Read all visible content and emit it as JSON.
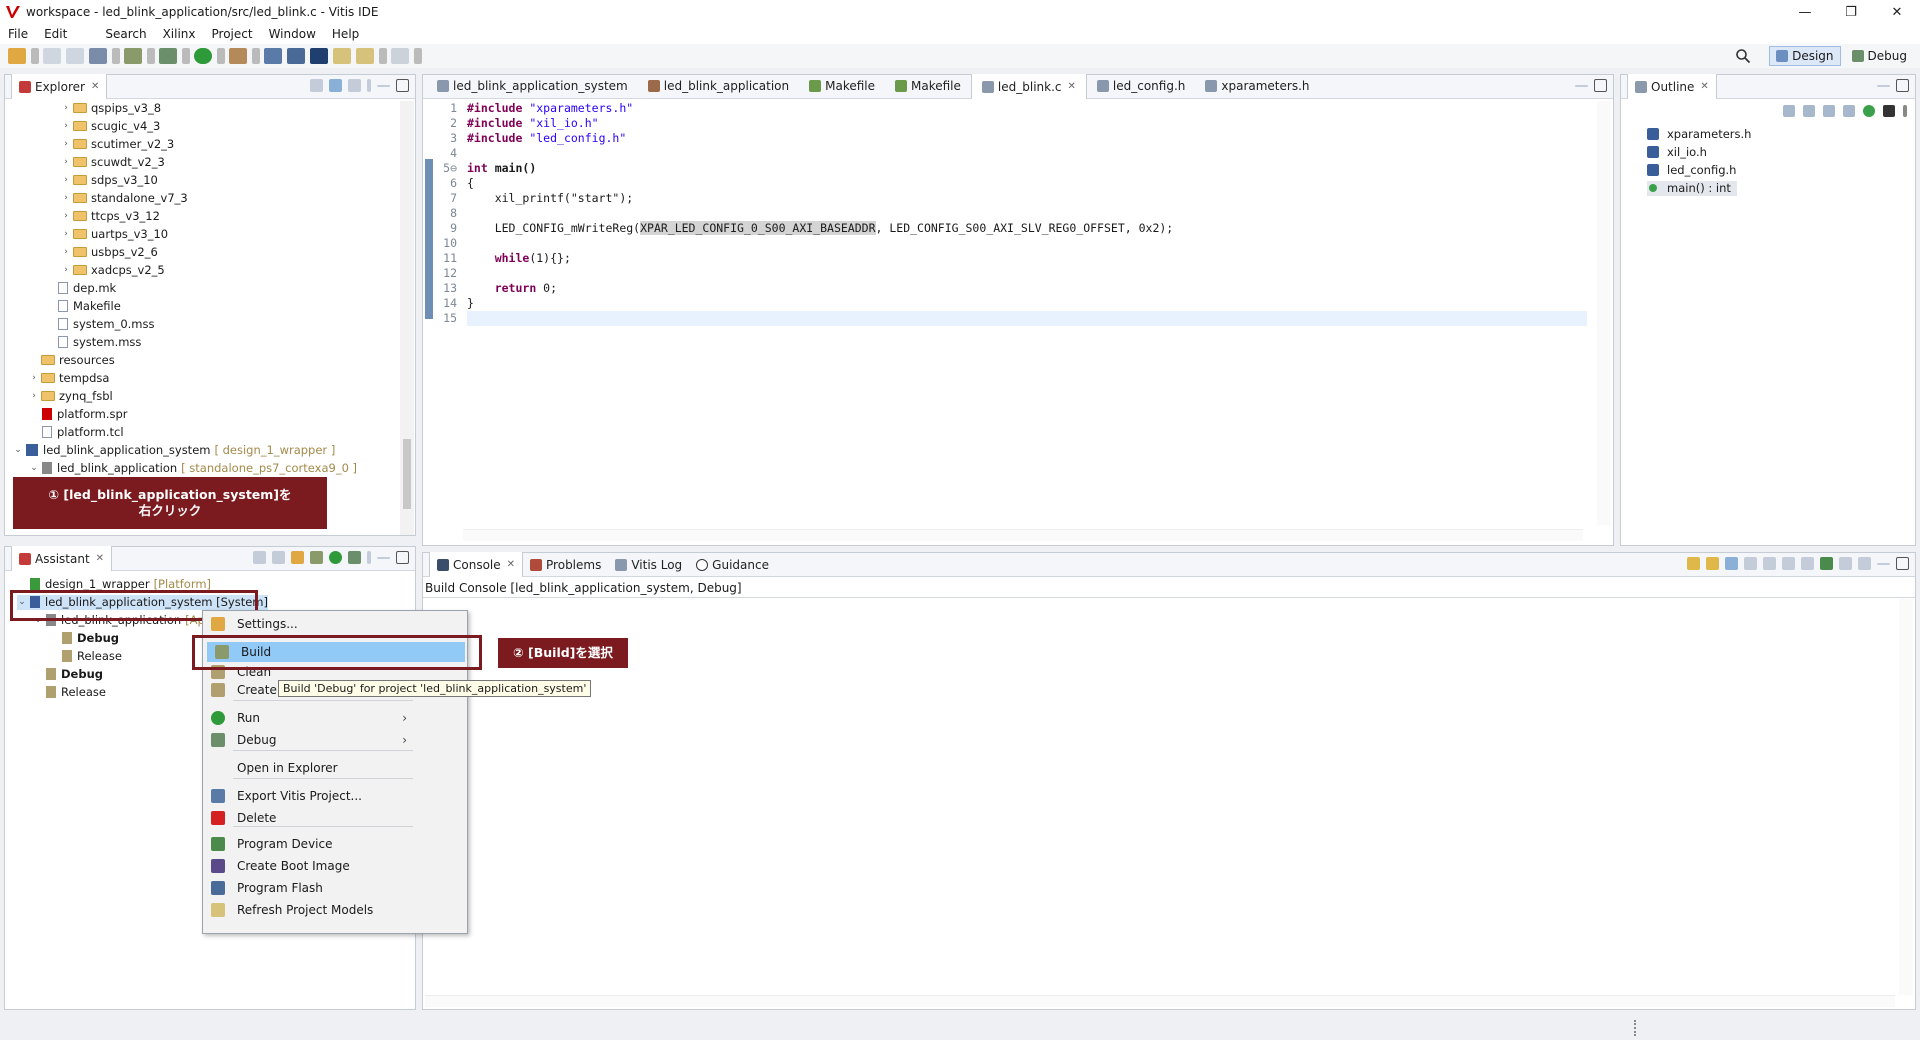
{
  "window": {
    "title": "workspace - led_blink_application/src/led_blink.c - Vitis IDE",
    "min": "—",
    "max": "❐",
    "close": "✕"
  },
  "menu": [
    "File",
    "Edit",
    "Search",
    "Xilinx",
    "Project",
    "Window",
    "Help"
  ],
  "perspectives": {
    "design": "Design",
    "debug": "Debug"
  },
  "explorer": {
    "title": "Explorer",
    "items": [
      {
        "label": "qspips_v3_8",
        "level": 3,
        "type": "folder",
        "arrow": "›"
      },
      {
        "label": "scugic_v4_3",
        "level": 3,
        "type": "folder",
        "arrow": "›"
      },
      {
        "label": "scutimer_v2_3",
        "level": 3,
        "type": "folder",
        "arrow": "›"
      },
      {
        "label": "scuwdt_v2_3",
        "level": 3,
        "type": "folder",
        "arrow": "›"
      },
      {
        "label": "sdps_v3_10",
        "level": 3,
        "type": "folder",
        "arrow": "›"
      },
      {
        "label": "standalone_v7_3",
        "level": 3,
        "type": "folder",
        "arrow": "›"
      },
      {
        "label": "ttcps_v3_12",
        "level": 3,
        "type": "folder",
        "arrow": "›"
      },
      {
        "label": "uartps_v3_10",
        "level": 3,
        "type": "folder",
        "arrow": "›"
      },
      {
        "label": "usbps_v2_6",
        "level": 3,
        "type": "folder",
        "arrow": "›"
      },
      {
        "label": "xadcps_v2_5",
        "level": 3,
        "type": "folder",
        "arrow": "›"
      },
      {
        "label": "dep.mk",
        "level": 2,
        "type": "file",
        "arrow": ""
      },
      {
        "label": "Makefile",
        "level": 2,
        "type": "file",
        "arrow": ""
      },
      {
        "label": "system_0.mss",
        "level": 2,
        "type": "file",
        "arrow": ""
      },
      {
        "label": "system.mss",
        "level": 2,
        "type": "file",
        "arrow": ""
      },
      {
        "label": "resources",
        "level": 1,
        "type": "folder",
        "arrow": ""
      },
      {
        "label": "tempdsa",
        "level": 1,
        "type": "folder",
        "arrow": "›"
      },
      {
        "label": "zynq_fsbl",
        "level": 1,
        "type": "folder",
        "arrow": "›"
      },
      {
        "label": "platform.spr",
        "level": 1,
        "type": "vitis",
        "arrow": ""
      },
      {
        "label": "platform.tcl",
        "level": 1,
        "type": "file",
        "arrow": ""
      },
      {
        "label": "led_blink_application_system",
        "deco": "[ design_1_wrapper ]",
        "level": 0,
        "type": "system",
        "arrow": "⌄"
      },
      {
        "label": "led_blink_application",
        "deco": "[ standalone_ps7_cortexa9_0 ]",
        "level": 1,
        "type": "app",
        "arrow": "⌄"
      }
    ]
  },
  "callout1": {
    "line1": "① [led_blink_application_system]を",
    "line2": "右クリック"
  },
  "callout2": "② [Build]を選択",
  "assistant": {
    "title": "Assistant",
    "items": [
      {
        "label": "design_1_wrapper",
        "deco": "[Platform]",
        "level": 0
      },
      {
        "label": "led_blink_application_system [System]",
        "level": 0
      },
      {
        "label": "led_blink_application",
        "deco": "[App...",
        "level": 1
      },
      {
        "label": "Debug",
        "level": 2,
        "bold": true
      },
      {
        "label": "Release",
        "level": 2
      },
      {
        "label": "Debug",
        "level": 1,
        "bold": true
      },
      {
        "label": "Release",
        "level": 1
      }
    ]
  },
  "editor": {
    "tabs": [
      {
        "label": "led_blink_application_system"
      },
      {
        "label": "led_blink_application"
      },
      {
        "label": "Makefile"
      },
      {
        "label": "Makefile"
      },
      {
        "label": "led_blink.c",
        "selected": true,
        "close": "✕"
      },
      {
        "label": "led_config.h"
      },
      {
        "label": "xparameters.h"
      }
    ],
    "line_numbers": [
      "1",
      "2",
      "3",
      "4",
      "5⊖",
      "6",
      "7",
      "8",
      "9",
      "10",
      "11",
      "12",
      "13",
      "14",
      "15"
    ],
    "code": {
      "l1": "\"xparameters.h\"",
      "l2": "\"xil_io.h\"",
      "l3": "\"led_config.h\"",
      "include": "#include",
      "int": "int",
      "main": " main()",
      "brace_open": "{",
      "l7": "    xil_printf(\"start\");",
      "l9a": "    LED_CONFIG_mWriteReg(",
      "l9b": "XPAR_LED_CONFIG_0_S00_AXI_BASEADDR",
      "l9c": ", LED_CONFIG_S00_AXI_SLV_REG0_OFFSET, 0x2);",
      "while": "while",
      "l11": "(1){};",
      "return": "return",
      "l13": " 0;",
      "brace_close": "}"
    }
  },
  "outline": {
    "title": "Outline",
    "items": [
      "xparameters.h",
      "xil_io.h",
      "led_config.h",
      "main() : int"
    ]
  },
  "console": {
    "tabs": [
      "Console",
      "Problems",
      "Vitis Log",
      "Guidance"
    ],
    "header": "Build Console [led_blink_application_system, Debug]"
  },
  "context_menu": {
    "items": [
      {
        "label": "Settings...",
        "y": 0
      },
      {
        "label": "Build",
        "highlight": true
      },
      {
        "label": "Clean"
      },
      {
        "label": "Create"
      },
      {
        "label": "Run",
        "sub": "›"
      },
      {
        "label": "Debug",
        "sub": "›"
      },
      {
        "label": "Open in Explorer"
      },
      {
        "label": "Export Vitis Project..."
      },
      {
        "label": "Delete"
      },
      {
        "label": "Program Device"
      },
      {
        "label": "Create Boot Image"
      },
      {
        "label": "Program Flash"
      },
      {
        "label": "Refresh Project Models"
      }
    ],
    "tooltip": "Build 'Debug' for project 'led_blink_application_system'"
  }
}
